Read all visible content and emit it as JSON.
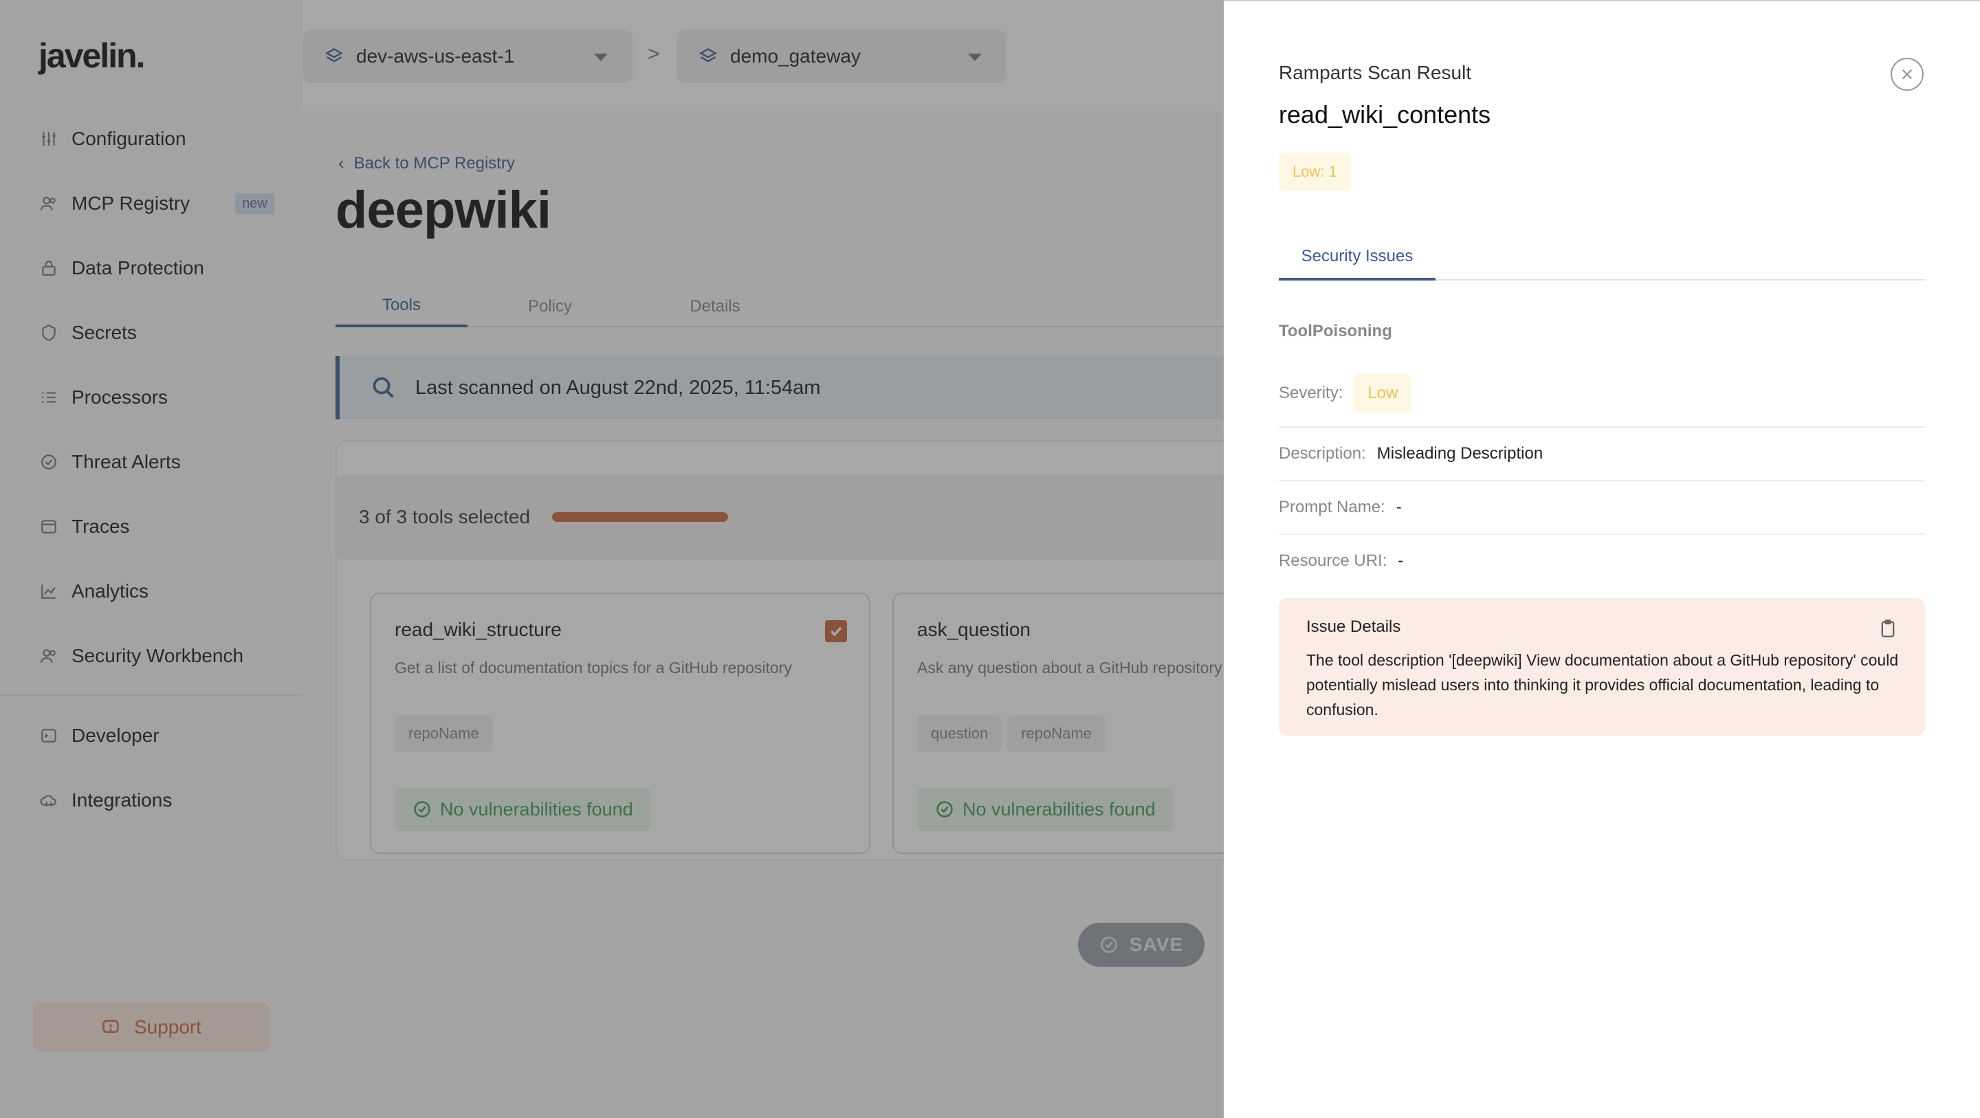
{
  "sidebar": {
    "logo": "javelin.",
    "items": [
      {
        "label": "Configuration",
        "icon": "sliders-icon"
      },
      {
        "label": "MCP Registry",
        "icon": "users-icon",
        "badge": "new"
      },
      {
        "label": "Data Protection",
        "icon": "lock-icon"
      },
      {
        "label": "Secrets",
        "icon": "shield-icon"
      },
      {
        "label": "Processors",
        "icon": "list-icon"
      },
      {
        "label": "Threat Alerts",
        "icon": "shield-check-icon"
      },
      {
        "label": "Traces",
        "icon": "window-icon"
      },
      {
        "label": "Analytics",
        "icon": "chart-line-icon"
      },
      {
        "label": "Security Workbench",
        "icon": "users-icon"
      },
      {
        "label": "Developer",
        "icon": "terminal-icon"
      },
      {
        "label": "Integrations",
        "icon": "cloud-icon"
      }
    ],
    "support_label": "Support"
  },
  "topbar": {
    "environment": "dev-aws-us-east-1",
    "gateway": "demo_gateway",
    "separator": ">"
  },
  "main": {
    "back_link": "Back to MCP Registry",
    "title": "deepwiki",
    "tabs": [
      {
        "label": "Tools",
        "active": true
      },
      {
        "label": "Policy",
        "active": false
      },
      {
        "label": "Details",
        "active": false
      }
    ],
    "scan_banner": "Last scanned on August 22nd, 2025, 11:54am",
    "selected_text": "3 of 3 tools selected",
    "selected_fraction": 1.0,
    "tools": [
      {
        "name": "read_wiki_structure",
        "description": "Get a list of documentation topics for a GitHub repository",
        "params": [
          "repoName"
        ],
        "status": "No vulnerabilities found",
        "checked": true
      },
      {
        "name": "ask_question",
        "description": "Ask any question about a GitHub repository",
        "params": [
          "question",
          "repoName"
        ],
        "status": "No vulnerabilities found",
        "checked": true
      }
    ],
    "save_label": "SAVE"
  },
  "drawer": {
    "label": "Ramparts Scan Result",
    "title": "read_wiki_contents",
    "severity_summary": "Low: 1",
    "tab": "Security Issues",
    "issue_type": "ToolPoisoning",
    "severity_key": "Severity:",
    "severity_value": "Low",
    "description_key": "Description:",
    "description_value": "Misleading Description",
    "prompt_key": "Prompt Name:",
    "prompt_value": "-",
    "resource_key": "Resource URI:",
    "resource_value": "-",
    "issue_details_heading": "Issue Details",
    "issue_details_body": "The tool description '[deepwiki] View documentation about a GitHub repository' could potentially mislead users into thinking it provides official documentation, leading to confusion."
  },
  "colors": {
    "accent": "#3b5b8f",
    "brand_orange": "#c8643a",
    "success": "#3f9a55",
    "warning": "#e8c45a"
  }
}
